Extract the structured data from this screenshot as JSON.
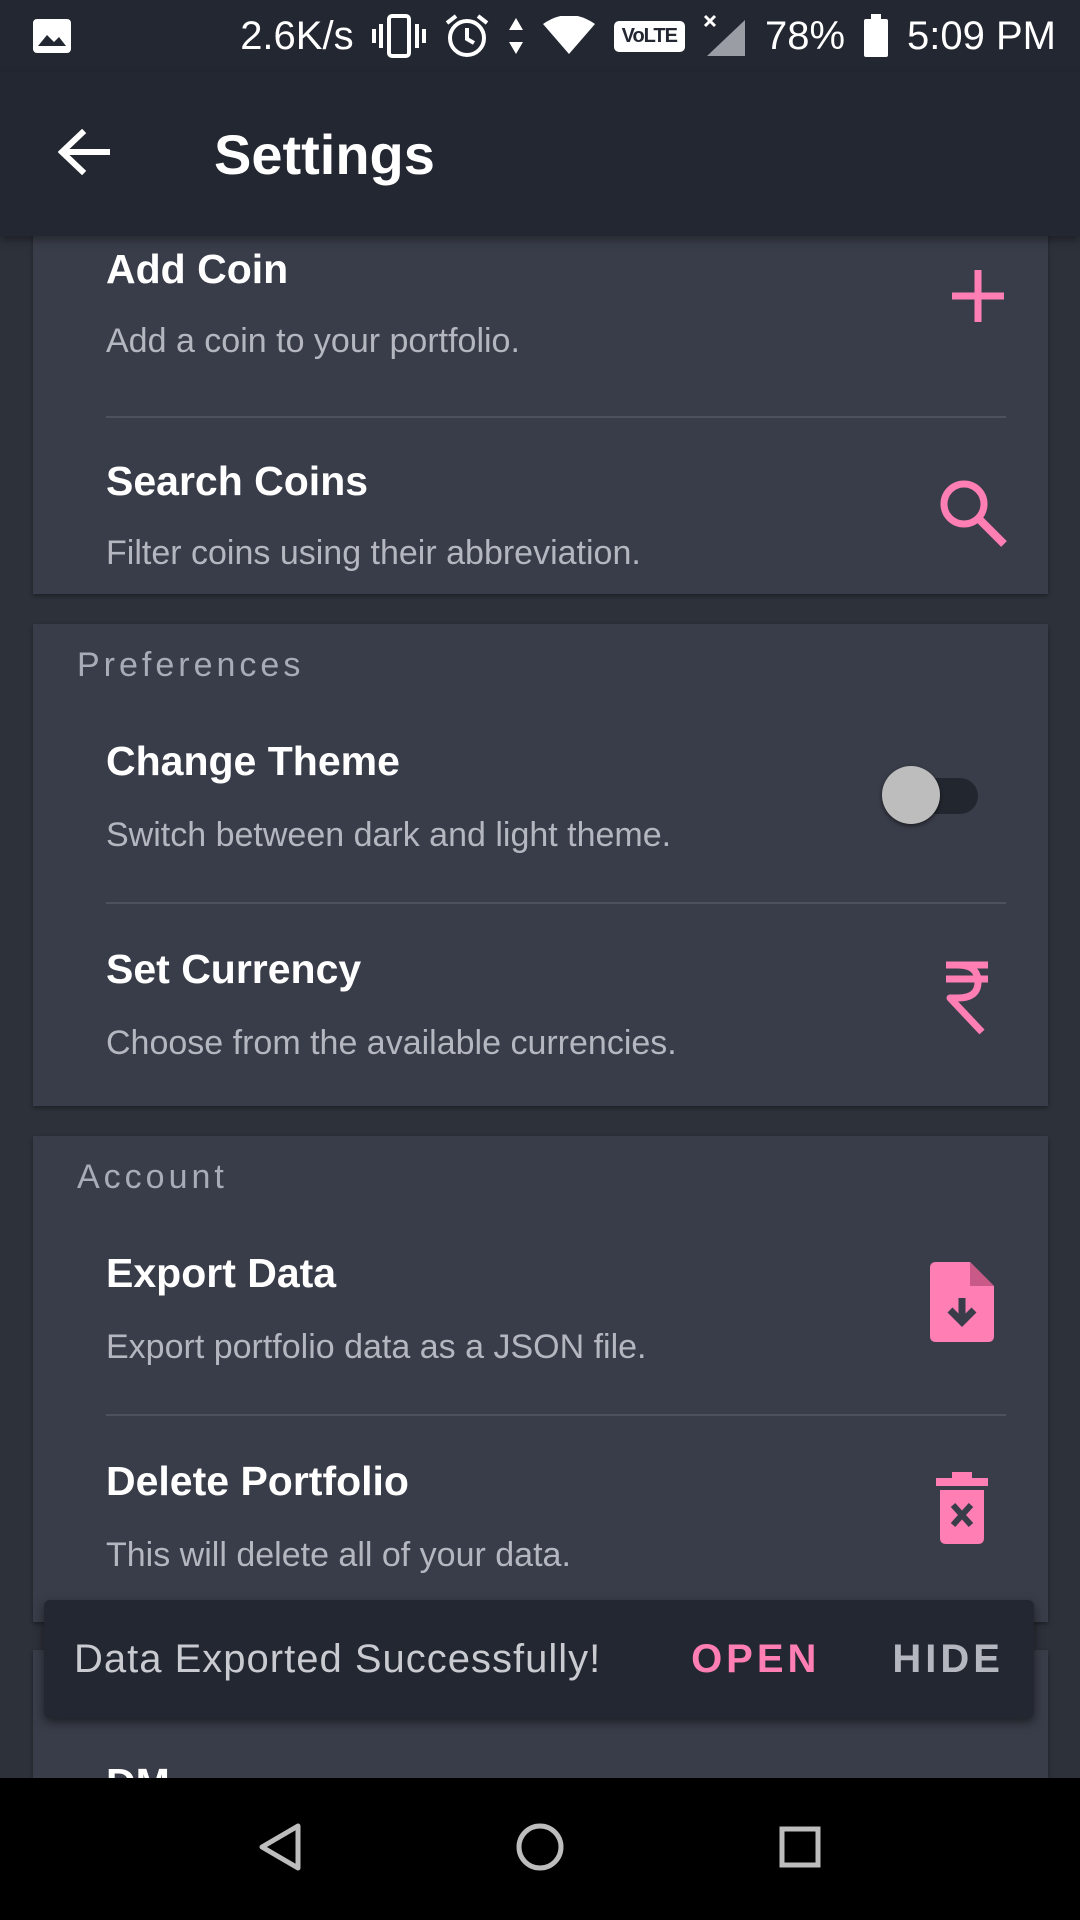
{
  "status_bar": {
    "speed": "2.6K/s",
    "network_badge": "VoLTE",
    "battery": "78%",
    "time": "5:09 PM",
    "icons": [
      "image-icon",
      "vibrate-icon",
      "alarm-icon",
      "data-arrows-icon",
      "wifi-icon",
      "signal-icon",
      "battery-icon"
    ]
  },
  "app_bar": {
    "title": "Settings",
    "back_icon": "arrow-left-icon"
  },
  "colors": {
    "accent": "#ff7eb3",
    "background": "#2d313a",
    "card": "#393d49",
    "app_bar": "#232731"
  },
  "general": {
    "add_coin": {
      "title": "Add Coin",
      "subtitle": "Add a coin to your portfolio.",
      "icon": "plus-icon"
    },
    "search_coins": {
      "title": "Search Coins",
      "subtitle": "Filter coins using their abbreviation.",
      "icon": "search-icon"
    }
  },
  "preferences": {
    "header": "Preferences",
    "change_theme": {
      "title": "Change Theme",
      "subtitle": "Switch between dark and light theme.",
      "toggle_on": false
    },
    "set_currency": {
      "title": "Set Currency",
      "subtitle": "Choose from the available currencies.",
      "icon": "rupee-icon"
    }
  },
  "account": {
    "header": "Account",
    "export_data": {
      "title": "Export Data",
      "subtitle": "Export portfolio data as a JSON file.",
      "icon": "file-download-icon"
    },
    "delete_portfolio": {
      "title": "Delete Portfolio",
      "subtitle": "This will delete all of your data.",
      "icon": "trash-icon"
    }
  },
  "next_card_peek": "DM",
  "snackbar": {
    "message": "Data Exported Successfully!",
    "open_label": "OPEN",
    "hide_label": "HIDE"
  },
  "nav_bar": {
    "icons": [
      "back-triangle-icon",
      "home-circle-icon",
      "recents-square-icon"
    ]
  }
}
